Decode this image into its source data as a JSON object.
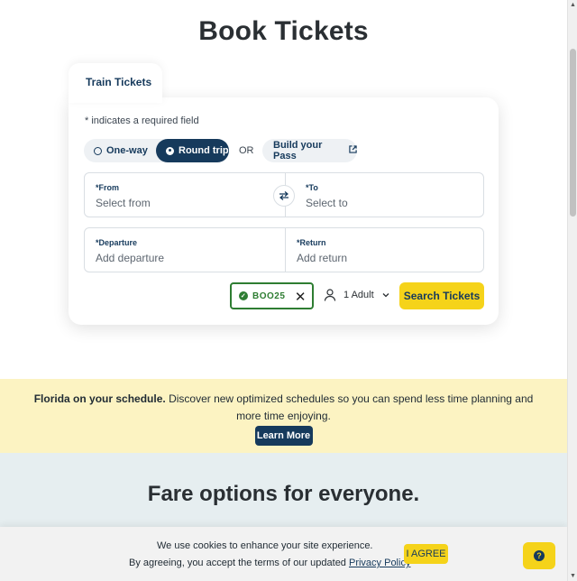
{
  "page": {
    "title": "Book Tickets"
  },
  "booking": {
    "tab_label": "Train Tickets",
    "required_note": "* indicates a required field",
    "trip_types": [
      {
        "label": "One-way",
        "selected": false
      },
      {
        "label": "Round trip",
        "selected": true
      }
    ],
    "or_label": "OR",
    "pass_button": "Build your Pass",
    "from": {
      "label": "*From",
      "placeholder": "Select from"
    },
    "to": {
      "label": "*To",
      "placeholder": "Select to"
    },
    "departure": {
      "label": "*Departure",
      "placeholder": "Add departure"
    },
    "return": {
      "label": "*Return",
      "placeholder": "Add return"
    },
    "promo_code": "BOO25",
    "passengers": "1 Adult",
    "search_button": "Search Tickets"
  },
  "banner": {
    "headline": "Florida on your schedule.",
    "text": " Discover new optimized schedules so you can spend less time planning and more time enjoying.",
    "button": "Learn More"
  },
  "fares": {
    "title": "Fare options for everyone."
  },
  "cookie": {
    "line1": "We use cookies to enhance your site experience.",
    "line2": "By agreeing, you accept the terms of our updated ",
    "link": "Privacy Policy",
    "agree_button": "I AGREE"
  },
  "icons": {
    "swap": "swap-arrows-icon",
    "external": "external-link-icon",
    "person": "person-icon",
    "check": "check-circle-icon",
    "close": "close-icon",
    "help": "help-chat-icon"
  },
  "colors": {
    "navy": "#163a5c",
    "yellow": "#f5d31a",
    "banner_bg": "#fcf3c2",
    "fares_bg": "#e6eef0",
    "promo_green": "#2e7d32"
  }
}
